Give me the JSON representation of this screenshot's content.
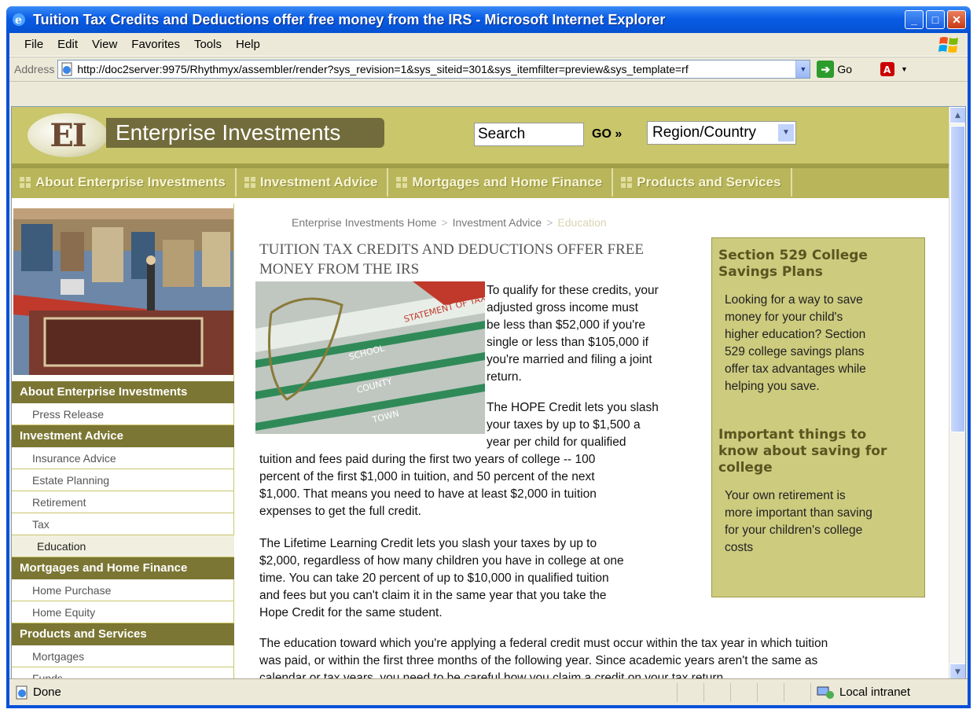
{
  "window": {
    "title": "Tuition Tax Credits and Deductions offer free money from the IRS - Microsoft Internet Explorer",
    "controls": {
      "minimize": "_",
      "maximize": "□",
      "close": "✕"
    }
  },
  "menubar": [
    "File",
    "Edit",
    "View",
    "Favorites",
    "Tools",
    "Help"
  ],
  "addressbar": {
    "label": "Address",
    "url": "http://doc2server:9975/Rhythmyx/assembler/render?sys_revision=1&sys_siteid=301&sys_itemfilter=preview&sys_template=rf",
    "go_label": "Go"
  },
  "site": {
    "brand": "Enterprise Investments",
    "search_placeholder": "Search",
    "go_label": "GO »",
    "region_label": "Region/Country",
    "topnav": [
      "About Enterprise Investments",
      "Investment Advice",
      "Mortgages and Home Finance",
      "Products and Services"
    ]
  },
  "leftnav": [
    {
      "heading": "About Enterprise Investments",
      "items": [
        "Press Release"
      ]
    },
    {
      "heading": "Investment Advice",
      "items": [
        "Insurance Advice",
        "Estate Planning",
        "Retirement",
        "Tax",
        "Education"
      ]
    },
    {
      "heading": "Mortgages and Home Finance",
      "items": [
        "Home Purchase",
        "Home Equity"
      ]
    },
    {
      "heading": "Products and Services",
      "items": [
        "Mortgages",
        "Funds"
      ]
    }
  ],
  "breadcrumb": {
    "home": "Enterprise Investments Home",
    "section": "Investment Advice",
    "current": "Education",
    "separator": ">"
  },
  "article": {
    "title": "TUITION TAX CREDITS AND DEDUCTIONS OFFER FREE MONEY FROM THE IRS",
    "p1_wrap": [
      "To qualify for these credits, your",
      "adjusted gross income must",
      "be less than $52,000 if you're",
      "single or less than $105,000 if",
      "you're married and filing a joint",
      "return."
    ],
    "p2_wrap": [
      "The HOPE Credit lets you slash",
      "your taxes by up to $1,500 a",
      "year per child for qualified"
    ],
    "p2_full": [
      "tuition and fees paid during the first two years of college -- 100",
      "percent of the first $1,000 in tuition, and 50 percent of the next",
      "$1,000. That means you need to have at least $2,000 in tuition",
      "expenses to get the full credit."
    ],
    "p3": [
      "The Lifetime Learning Credit lets you slash your taxes by up to",
      "$2,000, regardless of how many children you have in college at one",
      "time. You can take 20 percent of up to $10,000 in qualified tuition",
      "and fees but you can't claim it in the same year that you take the",
      "Hope Credit for the same student."
    ],
    "p4": [
      "The education toward which you're applying a federal credit must occur within the tax year in which tuition",
      "was paid, or within the first three months of the following year. Since academic years aren't the same as",
      "calendar or tax years, you need to be careful how you claim a credit on your tax return."
    ]
  },
  "sidebar": {
    "heading1": [
      "Section 529 College",
      "Savings Plans"
    ],
    "body1": [
      "Looking for a way to save",
      "money for your child's",
      "higher education? Section",
      "529 college savings plans",
      "offer tax advantages while",
      "helping you save."
    ],
    "heading2": [
      "Important things to",
      "know about saving for",
      "college"
    ],
    "body2": [
      "Your own retirement is",
      "more important than saving",
      "for your children's college",
      "costs"
    ]
  },
  "statusbar": {
    "status": "Done",
    "zone": "Local intranet"
  },
  "image_labels": {
    "statement": "STATEMENT OF TAXES",
    "school": "SCHOOL",
    "county": "COUNTY",
    "town": "TOWN"
  }
}
